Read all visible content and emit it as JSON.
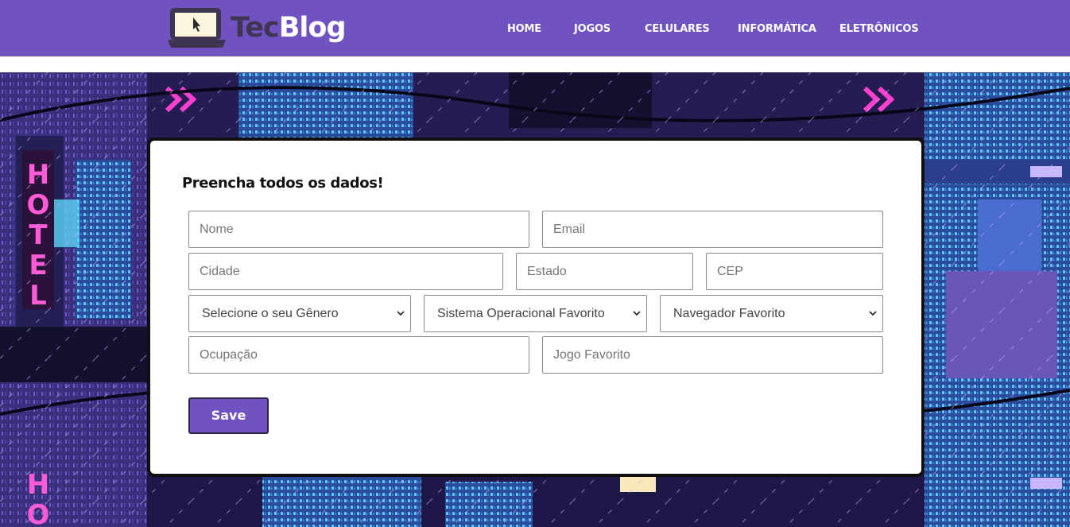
{
  "brand": {
    "part1": "Tec",
    "part2": "Blog",
    "icon": "laptop-cursor-icon"
  },
  "nav": {
    "items": [
      "HOME",
      "JOGOS",
      "CELULARES",
      "INFORMÁTICA",
      "ELETRÔNICOS"
    ]
  },
  "background": {
    "neon_sign": "HOTEL"
  },
  "form": {
    "title": "Preencha todos os dados!",
    "nome_placeholder": "Nome",
    "email_placeholder": "Email",
    "cidade_placeholder": "Cidade",
    "estado_placeholder": "Estado",
    "cep_placeholder": "CEP",
    "genero_selected": "Selecione o seu Gênero",
    "sistema_selected": "Sistema Operacional Favorito",
    "navegador_selected": "Navegador Favorito",
    "ocupacao_placeholder": "Ocupação",
    "jogo_placeholder": "Jogo Favorito",
    "save_label": "Save"
  },
  "colors": {
    "brand": "#7152c1",
    "brand_dark": "#3e3553",
    "input_border": "#8a8a8a"
  }
}
